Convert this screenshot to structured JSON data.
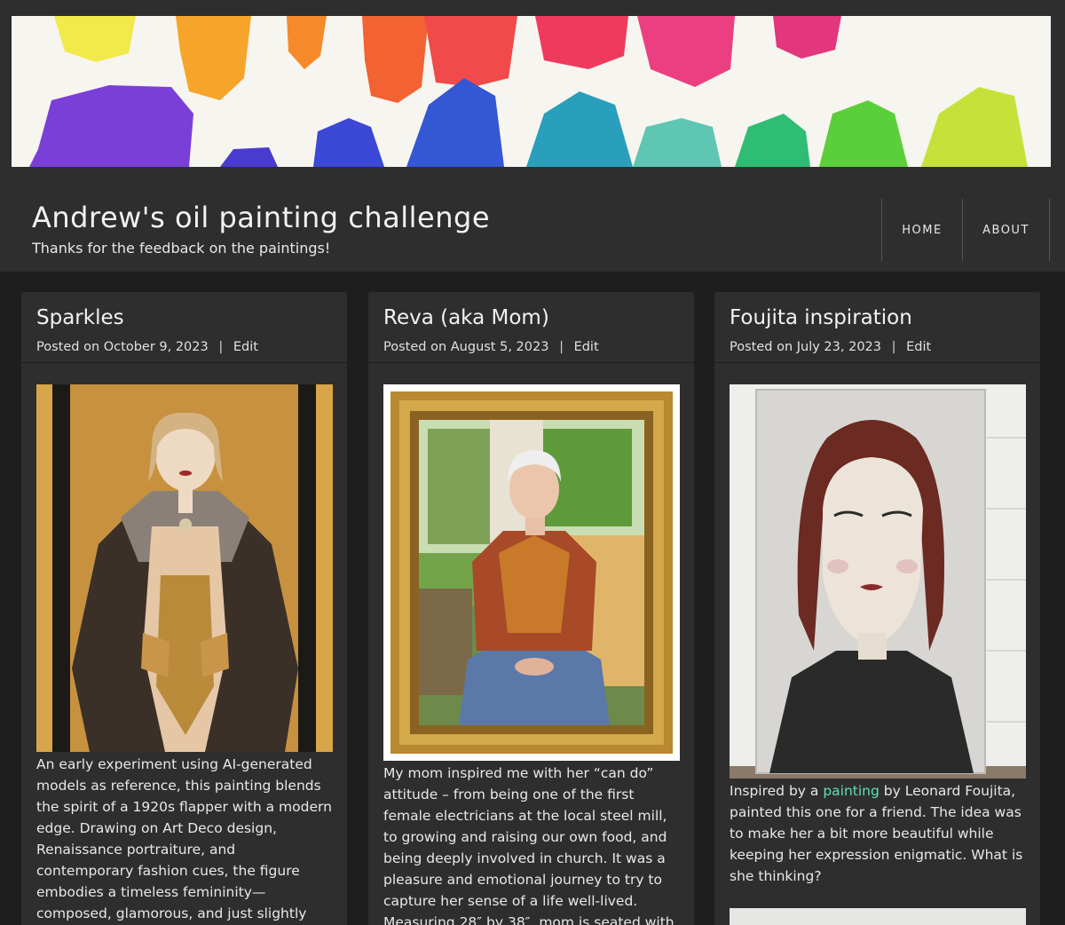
{
  "site": {
    "title": "Andrew's oil painting challenge",
    "description": "Thanks for the feedback on the paintings!"
  },
  "nav": {
    "items": [
      {
        "label": "HOME"
      },
      {
        "label": "ABOUT"
      }
    ]
  },
  "posts": [
    {
      "title": "Sparkles",
      "posted_prefix": "Posted on",
      "date": "October 9, 2023",
      "edit_label": "Edit",
      "excerpt": "An early experiment using AI-generated models as reference, this painting blends the spirit of a 1920s flapper with a modern edge. Drawing on Art Deco design, Renaissance portraiture, and contemporary fashion cues, the figure embodies a timeless femininity—composed, glamorous, and just slightly surreal."
    },
    {
      "title": "Reva (aka Mom)",
      "posted_prefix": "Posted on",
      "date": "August 5, 2023",
      "edit_label": "Edit",
      "excerpt": "My mom inspired me with her “can do” attitude – from being one of the first female electricians at the local steel mill, to growing and raising our own food, and being deeply involved in church. It was a pleasure and emotional journey to try to capture her sense of a life well-lived. Measuring 28″ by 38″, mom is seated with the family farm in the"
    },
    {
      "title": "Foujita inspiration",
      "posted_prefix": "Posted on",
      "date": "July 23, 2023",
      "edit_label": "Edit",
      "excerpt_before": "Inspired by a",
      "excerpt_link": "painting",
      "excerpt_after": "by Leonard Foujita, painted this one for a friend. The idea was to make her a bit more beautiful while keeping her expression enigmatic. What is she thinking?"
    }
  ],
  "colors": {
    "page_bg": "#1e1e1e",
    "header_bg": "#2e2e2e",
    "card_bg": "#2e2e2e",
    "link": "#5fe0b3"
  }
}
